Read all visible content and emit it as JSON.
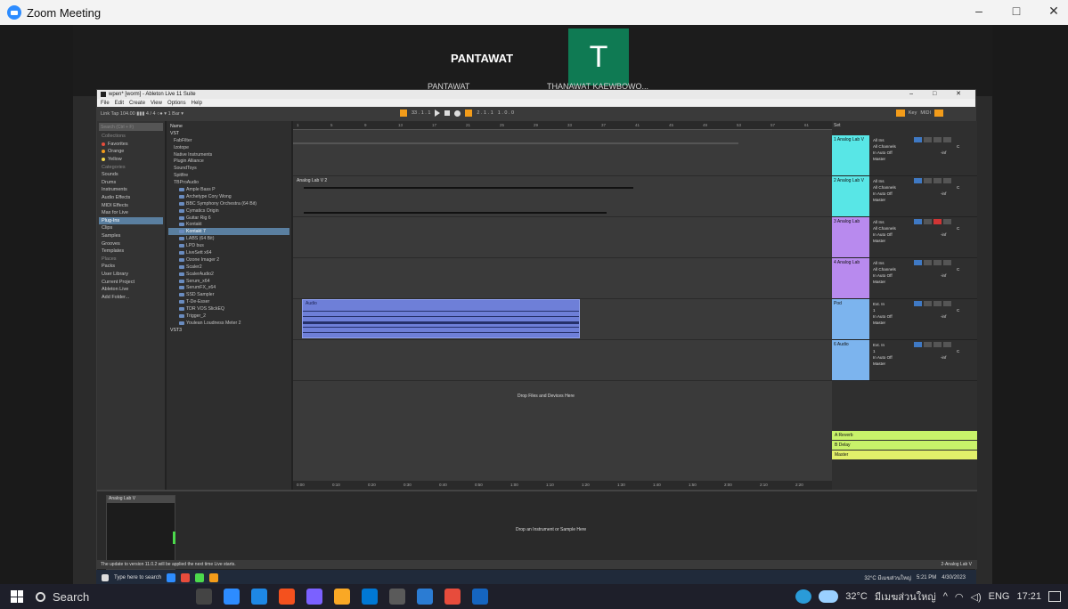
{
  "window": {
    "title": "Zoom Meeting",
    "minimize": "–",
    "maximize": "□",
    "close": "✕"
  },
  "participants": {
    "shown_name": "PANTAWAT",
    "tile_letter": "T",
    "caption_left": "PANTAWAT",
    "caption_right": "THANAWAT KAEWBOWO..."
  },
  "ableton": {
    "title": "wpen* [worm] - Ableton Live 11 Suite",
    "menu": [
      "File",
      "Edit",
      "Create",
      "View",
      "Options",
      "Help"
    ],
    "control_bar": {
      "left": "Link   Tap  104.00  ▮▮▮  4 / 4  ○●  ▾ 1 Bar ▾",
      "position": "33 . 1 . 1",
      "loop": "2 . 1 . 1",
      "end": "1 . 0 . 0",
      "key": "Key",
      "midi": "MIDI"
    },
    "browser_search_placeholder": "Search (Ctrl + F)",
    "collections_header": "Collections",
    "collections": [
      {
        "label": "Favorites",
        "color": "#e74c3c"
      },
      {
        "label": "Orange",
        "color": "#f39c1a"
      },
      {
        "label": "Yellow",
        "color": "#f1d54a"
      }
    ],
    "categories_header": "Categories",
    "categories": [
      "Sounds",
      "Drums",
      "Instruments",
      "Audio Effects",
      "MIDI Effects",
      "Max for Live",
      "Plug-Ins",
      "Clips",
      "Samples",
      "Grooves",
      "Templates"
    ],
    "selected_category": "Plug-Ins",
    "places_header": "Places",
    "places": [
      "Packs",
      "User Library",
      "Current Project",
      "Ableton Live",
      "Add Folder..."
    ],
    "folder_header": "Name",
    "folder_root": "VST",
    "folders": [
      "Ample Bass P",
      "Archetype Cory Wong",
      "BBC Symphony Orchestra (64 Bit)",
      "Cymatics Origin",
      "Guitar Rig 6",
      "Kontakt",
      "Kontakt 7",
      "LABS (64 Bit)",
      "LPD bus",
      "LiveSett x64",
      "Ozone Imager 2",
      "Scaler2",
      "ScalerAudio2",
      "Serum_x64",
      "SerumFX_x64",
      "SSD Sampler",
      "T-De-Esser",
      "TDR VOS SlickEQ",
      "Trigger_2",
      "Youlean Loudness Meter 2"
    ],
    "subfolders": [
      "FabFilter",
      "Izotope",
      "Native Instruments",
      "Plugin Alliance",
      "SoundToys",
      "Spitfire",
      "TBProAudio"
    ],
    "folder_tail": "VST3",
    "selected_folder": "Kontakt 7",
    "ruler_ticks": [
      "1",
      "5",
      "9",
      "13",
      "17",
      "21",
      "25",
      "29",
      "33",
      "37",
      "41",
      "45",
      "49",
      "53",
      "57",
      "61"
    ],
    "clip_names": [
      "Analog Lab V 2",
      "Audio"
    ],
    "drop_main": "Drop Files and Devices Here",
    "time_ticks": [
      "0:00",
      "0:10",
      "0:20",
      "0:30",
      "0:40",
      "0:50",
      "1:00",
      "1:10",
      "1:20",
      "1:30",
      "1:40",
      "1:50",
      "2:00",
      "2:10",
      "2:20"
    ],
    "mixer_header": "Set",
    "tracks": [
      {
        "name": "1 Analog Lab V",
        "color": "#58e6e6",
        "input": "All Ins",
        "channel": "All Channels",
        "monitor": "In  Auto  Off",
        "output": "Master",
        "vol": "-inf",
        "pan": "C"
      },
      {
        "name": "2 Analog Lab V",
        "color": "#58e6e6",
        "input": "All Ins",
        "channel": "All Channels",
        "monitor": "In  Auto  Off",
        "output": "Master",
        "vol": "-inf",
        "pan": "C"
      },
      {
        "name": "3 Analog Lab",
        "color": "#b88aee",
        "input": "All Ins",
        "channel": "All Channels",
        "monitor": "In  Auto  Off",
        "output": "Master",
        "vol": "-inf",
        "pan": "C"
      },
      {
        "name": "4 Analog Lab",
        "color": "#b88aee",
        "input": "All Ins",
        "channel": "All Channels",
        "monitor": "In  Auto  Off",
        "output": "Master",
        "vol": "-inf",
        "pan": "C"
      },
      {
        "name": "Pod",
        "color": "#7cb4ee",
        "input": "Ext. In",
        "channel": "1",
        "monitor": "In  Auto  Off",
        "output": "Master",
        "vol": "-inf",
        "pan": "C"
      },
      {
        "name": "6 Audio",
        "color": "#7cb4ee",
        "input": "Ext. In",
        "channel": "1",
        "monitor": "In  Auto  Off",
        "output": "Master",
        "vol": "-inf",
        "pan": "C"
      }
    ],
    "returns": [
      {
        "name": "A Reverb",
        "color": "#c8f26a"
      },
      {
        "name": "B Delay",
        "color": "#c8f26a"
      },
      {
        "name": "Master",
        "color": "#e2f06a"
      }
    ],
    "detail_device": "Analog Lab V",
    "detail_drop": "Drop an Instrument or Sample Here",
    "detail_left_labels": [
      "None",
      "None"
    ],
    "status_message": "The update to version 11.0.2 will be applied the next time Live starts.",
    "status_right": "2-Analog Lab V"
  },
  "inner_taskbar": {
    "search": "Type here to search",
    "weather": "32°C มีเมฆส่วนใหญ่",
    "time": "5:21 PM",
    "date": "4/30/2023"
  },
  "taskbar": {
    "search": "Search",
    "weather_temp": "32°C",
    "weather_text": "มีเมฆส่วนใหญ่",
    "lang": "ENG",
    "time": "17:21"
  }
}
